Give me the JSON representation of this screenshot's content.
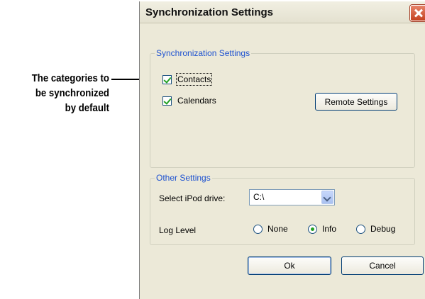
{
  "callout": {
    "line1": "The categories to",
    "line2": "be synchronized",
    "line3": "by default"
  },
  "window": {
    "title": "Synchronization Settings"
  },
  "sync_group": {
    "legend": "Synchronization Settings",
    "contacts_label": "Contacts",
    "contacts_checked": true,
    "calendars_label": "Calendars",
    "calendars_checked": true,
    "remote_settings_label": "Remote Settings"
  },
  "other_group": {
    "legend": "Other Settings",
    "ipod_label": "Select iPod drive:",
    "ipod_value": "C:\\",
    "log_label": "Log Level",
    "log_options": [
      "None",
      "Info",
      "Debug"
    ],
    "log_selected": "Info"
  },
  "footer": {
    "ok_label": "Ok",
    "cancel_label": "Cancel"
  }
}
